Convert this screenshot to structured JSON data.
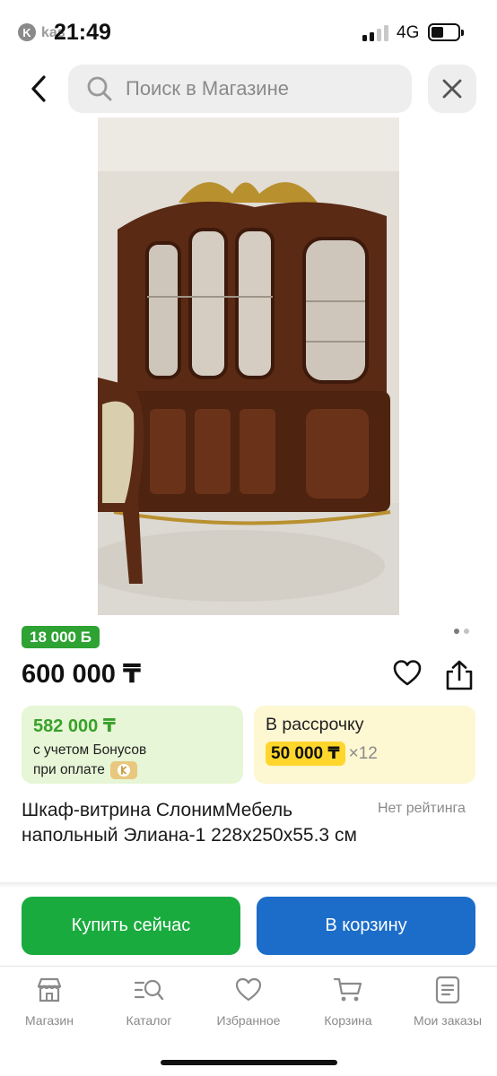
{
  "status_bar": {
    "time": "21:49",
    "brand_logo_letter": "K",
    "brand_partial": "kas",
    "network": "4G"
  },
  "header": {
    "search_placeholder": "Поиск в Магазине"
  },
  "product": {
    "bonus_badge": "18 000 Б",
    "price": "600 000 ₸",
    "title": "Шкаф-витрина СлонимМебель напольный Элиана-1 228x250x55.3 см",
    "rating_text": "Нет рейтинга",
    "image_pages": 2,
    "image_current": 1
  },
  "bonus_card": {
    "amount": "582 000 ₸",
    "line1": "с учетом Бонусов",
    "line2": "при оплате"
  },
  "installment_card": {
    "title": "В рассрочку",
    "amount": "50 000 ₸",
    "months": "×12"
  },
  "actions": {
    "buy_now": "Купить сейчас",
    "add_to_cart": "В корзину"
  },
  "bottom_nav": [
    {
      "label": "Магазин",
      "icon": "shop-icon"
    },
    {
      "label": "Каталог",
      "icon": "catalog-search-icon"
    },
    {
      "label": "Избранное",
      "icon": "heart-icon"
    },
    {
      "label": "Корзина",
      "icon": "cart-icon"
    },
    {
      "label": "Мои заказы",
      "icon": "orders-icon"
    }
  ],
  "colors": {
    "green_badge": "#2ea233",
    "buy_button": "#1aab3f",
    "cart_button": "#1b6dc9",
    "bonus_card_bg": "#e6f6d6",
    "installment_card_bg": "#fdf7d2",
    "installment_highlight": "#ffd62b"
  }
}
